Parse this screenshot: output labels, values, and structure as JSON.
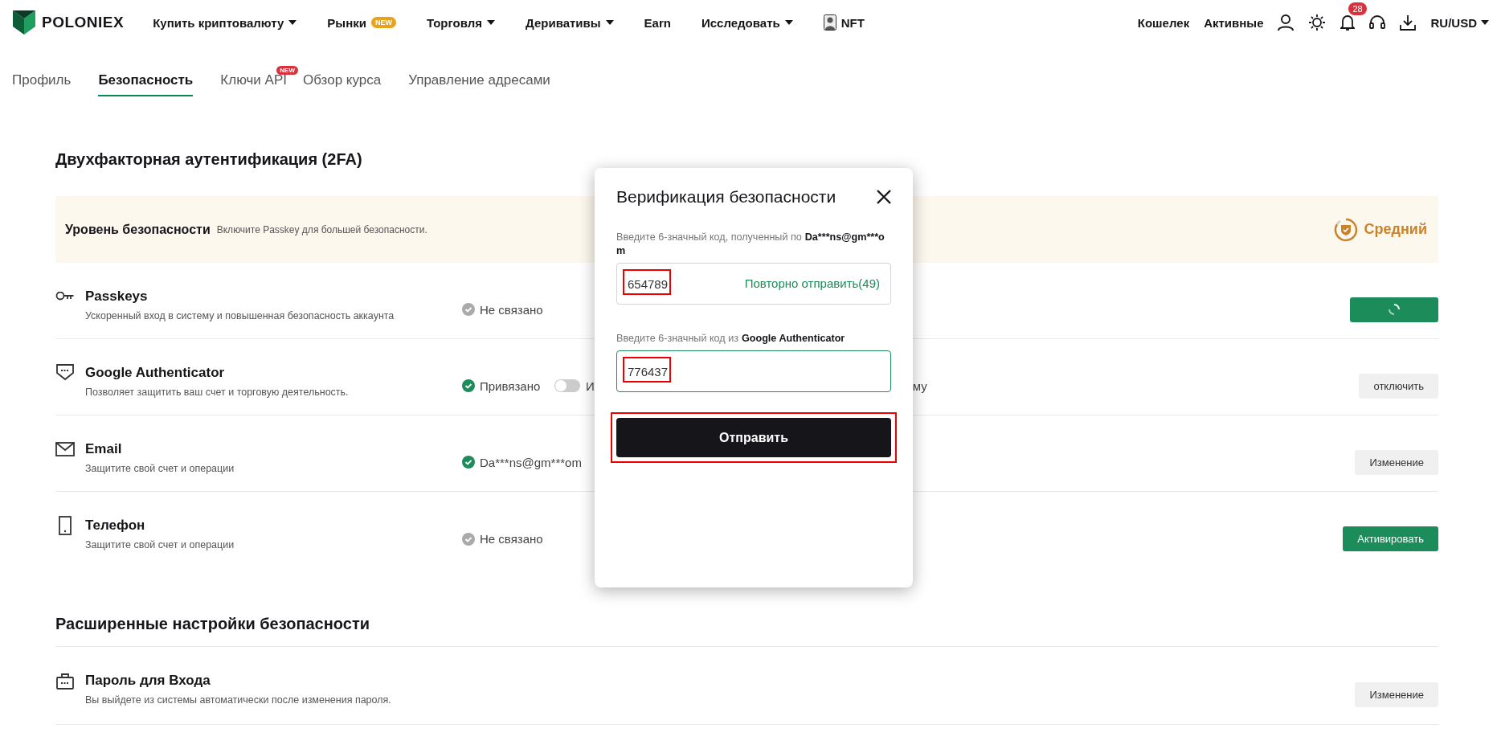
{
  "nav": {
    "logo": "POLONIEX",
    "menu": [
      {
        "label": "Купить криптовалюту",
        "caret": true
      },
      {
        "label": "Рынки",
        "badge": "NEW"
      },
      {
        "label": "Торговля",
        "caret": true
      },
      {
        "label": "Деривативы",
        "caret": true
      },
      {
        "label": "Earn"
      },
      {
        "label": "Исследовать",
        "caret": true
      },
      {
        "label": "NFT",
        "kind": "avatar"
      }
    ],
    "links": [
      "Кошелек",
      "Активные"
    ],
    "notifications": "28",
    "locale": "RU/USD"
  },
  "tabs": [
    {
      "label": "Профиль",
      "selected": false
    },
    {
      "label": "Безопасность",
      "selected": true
    },
    {
      "label": "Ключи API",
      "selected": false,
      "badge": "NEW"
    },
    {
      "label": "Обзор курса",
      "selected": false
    },
    {
      "label": "Управление адресами",
      "selected": false
    }
  ],
  "two_factor": {
    "title": "Двухфакторная аутентификация (2FA)",
    "level_banner": {
      "label": "Уровень безопасности",
      "hint": "Включите Passkey для большей безопасности.",
      "level": "Средний"
    },
    "rows": [
      {
        "kind": "key",
        "title": "Passkeys",
        "description": "Ускоренный вход в систему и повышенная безопасность аккаунта",
        "linked": false,
        "status": "Не связано",
        "button": {
          "kind": "loading"
        }
      },
      {
        "kind": "authenticator",
        "title": "Google Authenticator",
        "description": "Позволяет защитить ваш счет и торговую деятельность.",
        "linked": true,
        "status": "Привязано",
        "toggle": {
          "on": false
        },
        "fragment_left": "И",
        "fragment_right": "му",
        "button": {
          "kind": "secondary",
          "label": "отключить"
        }
      },
      {
        "kind": "email",
        "title": "Email",
        "description": "Защитите свой счет и операции",
        "linked": true,
        "status": "Da***ns@gm***om",
        "button": {
          "kind": "secondary",
          "label": "Изменение"
        }
      },
      {
        "kind": "phone",
        "title": "Телефон",
        "description": "Защитите свой счет и операции",
        "linked": false,
        "status": "Не связано",
        "button": {
          "kind": "primary",
          "label": "Активировать"
        }
      }
    ]
  },
  "advanced": {
    "title": "Расширенные настройки безопасности",
    "rows": [
      {
        "kind": "password",
        "title": "Пароль для Входа",
        "description": "Вы выйдете из системы автоматически после изменения пароля.",
        "button": {
          "kind": "secondary",
          "label": "Изменение"
        }
      }
    ]
  },
  "modal": {
    "title": "Верификация безопасности",
    "fields": [
      {
        "label": "Введите 6-значный код, полученный по",
        "target": "Da***ns@gm***om",
        "value": "654789",
        "action": "Повторно отправить(49)",
        "focused": false,
        "highlighted": true
      },
      {
        "label": "Введите 6-значный код из",
        "target": "Google Authenticator",
        "value": "776437",
        "focused": true,
        "highlighted": true
      }
    ],
    "submit": {
      "label": "Отправить",
      "highlighted": true
    }
  }
}
